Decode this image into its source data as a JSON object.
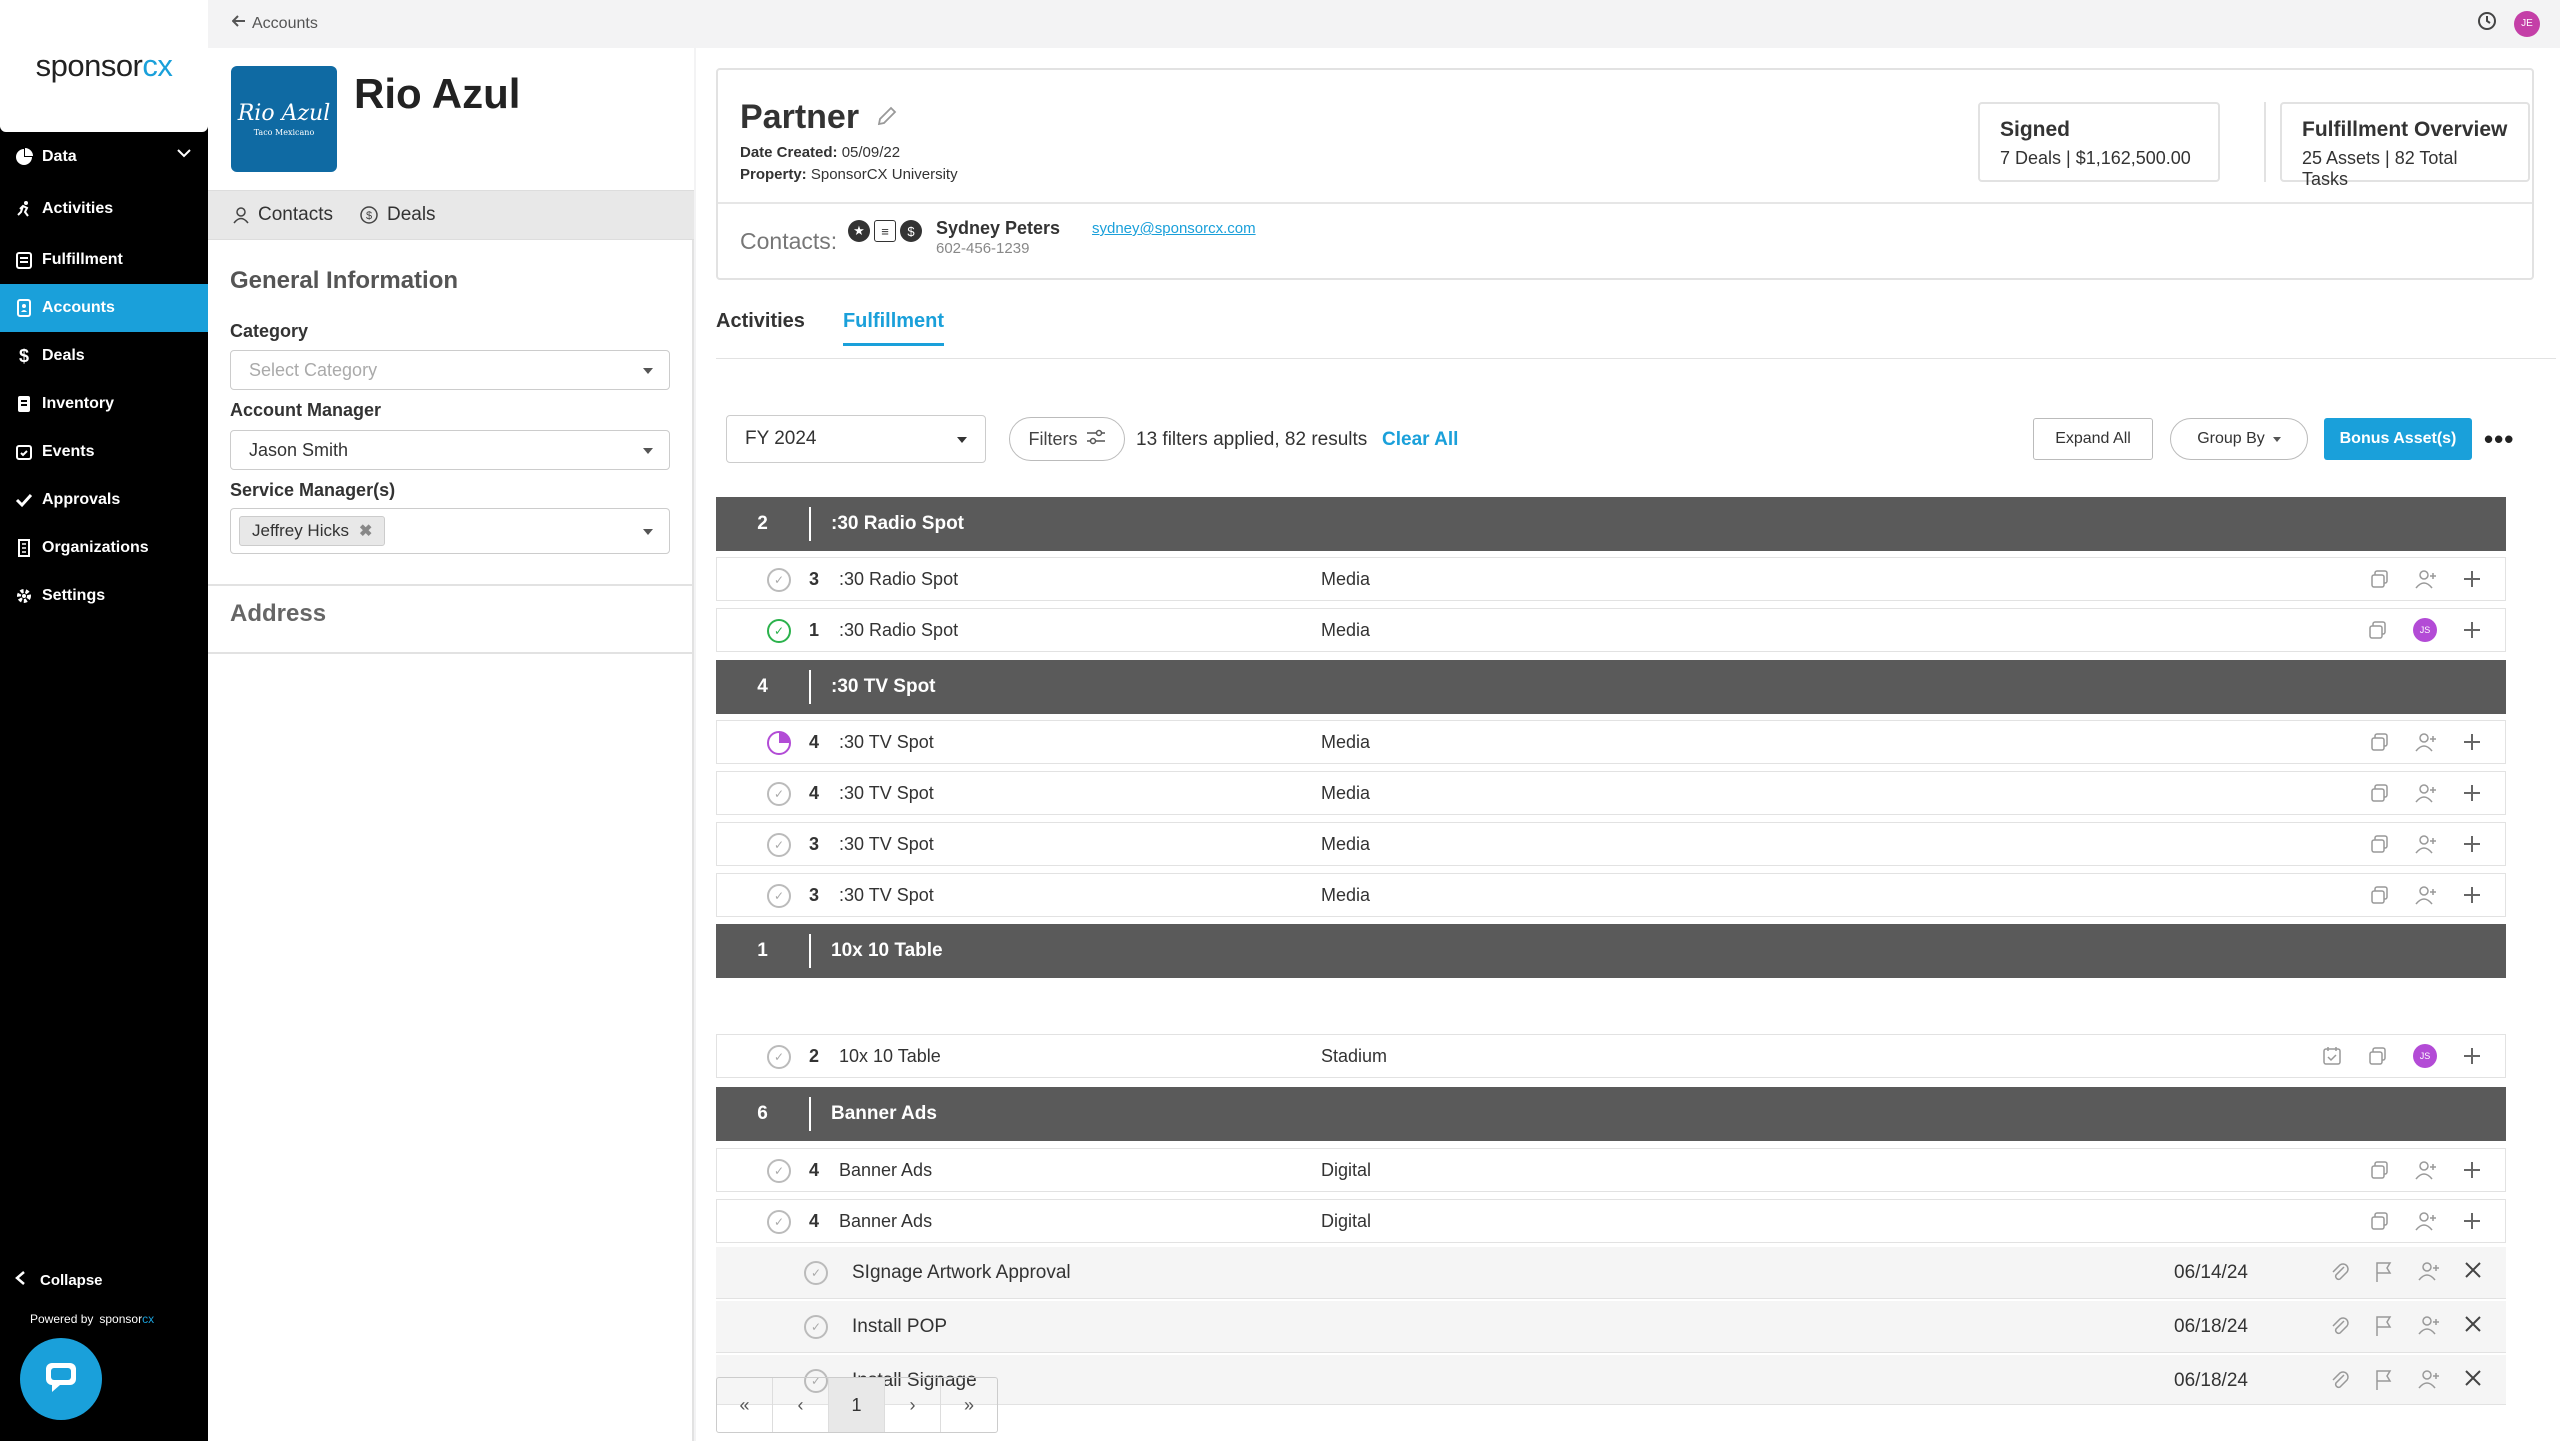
{
  "brand": {
    "logo_main": "sponsor",
    "logo_accent": "cx",
    "powered_by": "Powered by",
    "powered_main": "sponsor",
    "powered_accent": "cx"
  },
  "sidebar": {
    "items": [
      {
        "label": "Data"
      },
      {
        "label": "Activities"
      },
      {
        "label": "Fulfillment"
      },
      {
        "label": "Accounts"
      },
      {
        "label": "Deals"
      },
      {
        "label": "Inventory"
      },
      {
        "label": "Events"
      },
      {
        "label": "Approvals"
      },
      {
        "label": "Organizations"
      },
      {
        "label": "Settings"
      }
    ],
    "active": "Accounts",
    "collapse_label": "Collapse"
  },
  "topbar": {
    "back_label": "Accounts",
    "user_initials": "JE"
  },
  "account": {
    "name": "Rio Azul",
    "logo_text": "Rio Azul",
    "logo_sub": "Taco Mexicano",
    "tabs": {
      "contacts": "Contacts",
      "deals": "Deals"
    },
    "general_title": "General Information",
    "category_label": "Category",
    "category_placeholder": "Select Category",
    "manager_label": "Account Manager",
    "manager_value": "Jason Smith",
    "service_label": "Service Manager(s)",
    "service_chip": "Jeffrey Hicks",
    "address_title": "Address"
  },
  "deal": {
    "title": "Partner",
    "date_created_label": "Date Created:",
    "date_created": "05/09/22",
    "property_label": "Property:",
    "property": "SponsorCX University",
    "contacts_label": "Contacts:",
    "contact_name": "Sydney Peters",
    "contact_email": "sydney@sponsorcx.com",
    "contact_phone": "602-456-1239",
    "signed_title": "Signed",
    "signed_value": "7 Deals | $1,162,500.00",
    "overview_title": "Fulfillment Overview",
    "overview_value": "25 Assets | 82 Total Tasks"
  },
  "tabs": {
    "activities": "Activities",
    "fulfillment": "Fulfillment",
    "active": "Fulfillment"
  },
  "toolbar": {
    "fiscal_year": "FY 2024",
    "filters_label": "Filters",
    "filter_summary": "13 filters applied, 82 results",
    "clear_all": "Clear All",
    "expand_all": "Expand All",
    "group_by": "Group By",
    "bonus": "Bonus Asset(s)"
  },
  "groups": [
    {
      "count": "2",
      "name": ":30 Radio Spot"
    },
    {
      "count": "4",
      "name": ":30 TV Spot"
    },
    {
      "count": "1",
      "name": "10x 10 Table"
    },
    {
      "count": "6",
      "name": "Banner Ads"
    }
  ],
  "rows": [
    {
      "qty": "3",
      "name": ":30 Radio Spot",
      "type": "Media",
      "status": "open"
    },
    {
      "qty": "1",
      "name": ":30 Radio Spot",
      "type": "Media",
      "status": "done",
      "assignee": "JS"
    },
    {
      "qty": "4",
      "name": ":30 TV Spot",
      "type": "Media",
      "status": "partial"
    },
    {
      "qty": "4",
      "name": ":30 TV Spot",
      "type": "Media",
      "status": "open"
    },
    {
      "qty": "3",
      "name": ":30 TV Spot",
      "type": "Media",
      "status": "open"
    },
    {
      "qty": "3",
      "name": ":30 TV Spot",
      "type": "Media",
      "status": "open"
    },
    {
      "qty": "2",
      "name": "10x 10 Table",
      "type": "Stadium",
      "status": "open",
      "assignee": "JS"
    },
    {
      "qty": "4",
      "name": "Banner Ads",
      "type": "Digital",
      "status": "open"
    },
    {
      "qty": "4",
      "name": "Banner Ads",
      "type": "Digital",
      "status": "open"
    }
  ],
  "tasks": [
    {
      "name": "SIgnage Artwork Approval",
      "date": "06/14/24"
    },
    {
      "name": "Install POP",
      "date": "06/18/24"
    },
    {
      "name": "Install Signage",
      "date": "06/18/24"
    }
  ],
  "pager": {
    "first": "«",
    "prev": "‹",
    "current": "1",
    "next": "›",
    "last": "»"
  },
  "colors": {
    "accent": "#1aa0da",
    "group_bg": "#5a5a5a",
    "done": "#2bb24c",
    "partial": "#b24cd6"
  }
}
